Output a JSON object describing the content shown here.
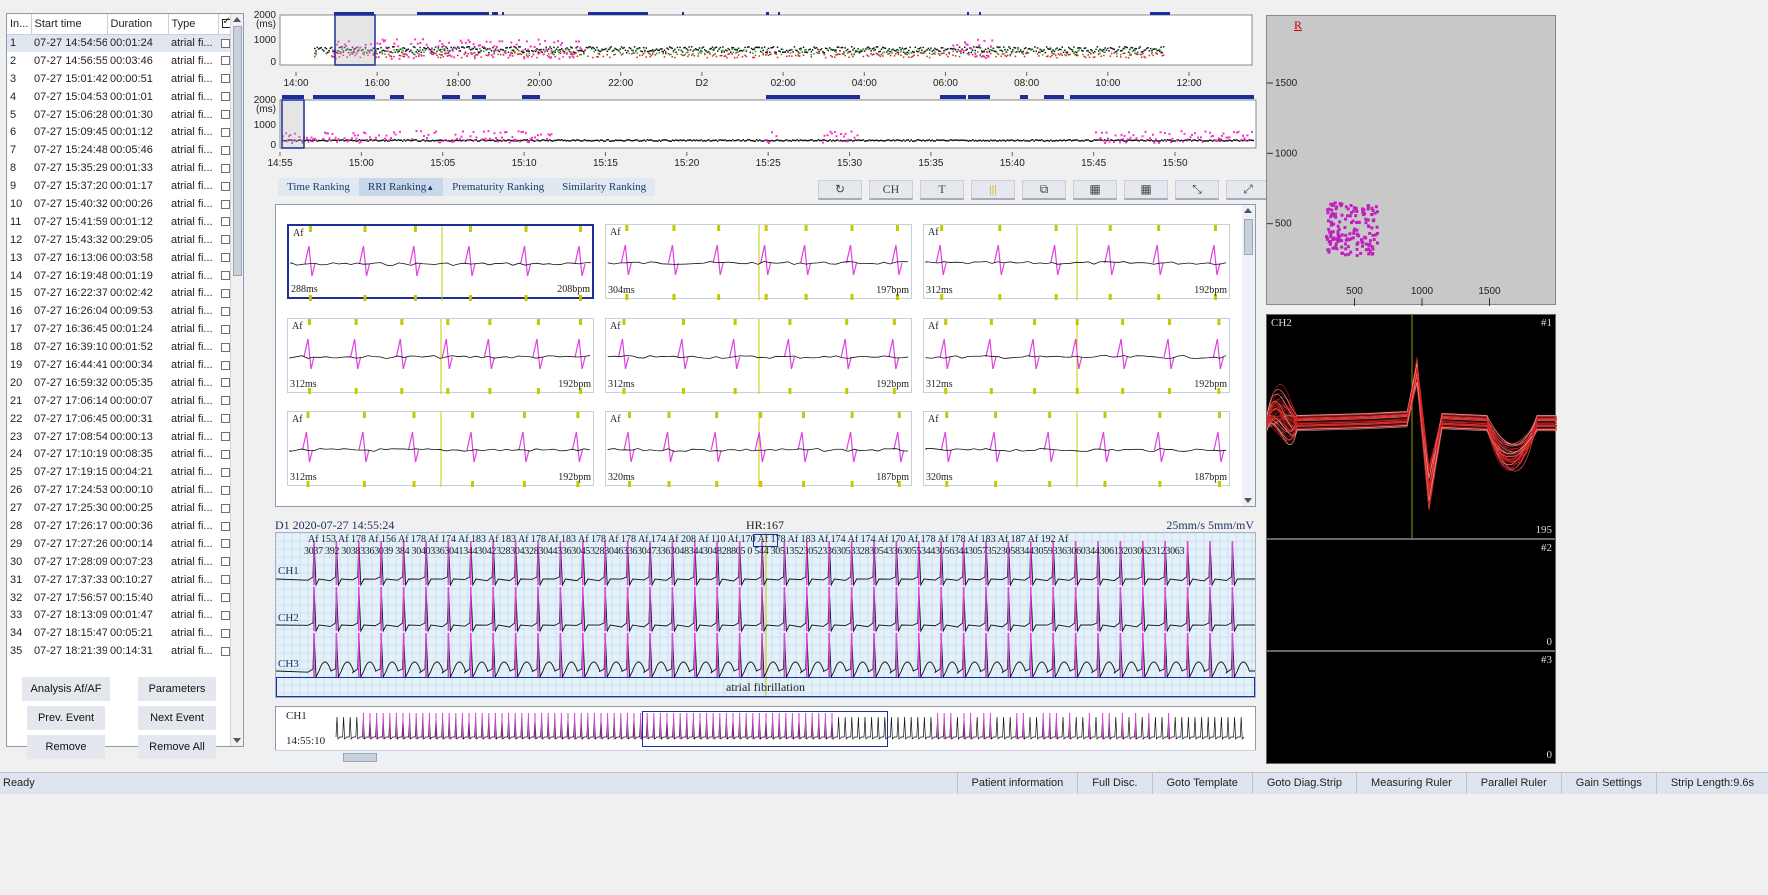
{
  "event_list": {
    "columns": [
      "In...",
      "Start time",
      "Duration",
      "Type"
    ],
    "header_checkbox_checked": true,
    "rows": [
      {
        "index": "1",
        "start": "07-27 14:54:56",
        "duration": "00:01:24",
        "type": "atrial fi..."
      },
      {
        "index": "2",
        "start": "07-27 14:56:55",
        "duration": "00:03:46",
        "type": "atrial fi..."
      },
      {
        "index": "3",
        "start": "07-27 15:01:42",
        "duration": "00:00:51",
        "type": "atrial fi..."
      },
      {
        "index": "4",
        "start": "07-27 15:04:53",
        "duration": "00:01:01",
        "type": "atrial fi..."
      },
      {
        "index": "5",
        "start": "07-27 15:06:28",
        "duration": "00:01:30",
        "type": "atrial fi..."
      },
      {
        "index": "6",
        "start": "07-27 15:09:45",
        "duration": "00:01:12",
        "type": "atrial fi..."
      },
      {
        "index": "7",
        "start": "07-27 15:24:48",
        "duration": "00:05:46",
        "type": "atrial fi..."
      },
      {
        "index": "8",
        "start": "07-27 15:35:29",
        "duration": "00:01:33",
        "type": "atrial fi..."
      },
      {
        "index": "9",
        "start": "07-27 15:37:20",
        "duration": "00:01:17",
        "type": "atrial fi..."
      },
      {
        "index": "10",
        "start": "07-27 15:40:32",
        "duration": "00:00:26",
        "type": "atrial fi..."
      },
      {
        "index": "11",
        "start": "07-27 15:41:59",
        "duration": "00:01:12",
        "type": "atrial fi..."
      },
      {
        "index": "12",
        "start": "07-27 15:43:32",
        "duration": "00:29:05",
        "type": "atrial fi..."
      },
      {
        "index": "13",
        "start": "07-27 16:13:06",
        "duration": "00:03:58",
        "type": "atrial fi..."
      },
      {
        "index": "14",
        "start": "07-27 16:19:48",
        "duration": "00:01:19",
        "type": "atrial fi..."
      },
      {
        "index": "15",
        "start": "07-27 16:22:37",
        "duration": "00:02:42",
        "type": "atrial fi..."
      },
      {
        "index": "16",
        "start": "07-27 16:26:04",
        "duration": "00:09:53",
        "type": "atrial fi..."
      },
      {
        "index": "17",
        "start": "07-27 16:36:45",
        "duration": "00:01:24",
        "type": "atrial fi..."
      },
      {
        "index": "18",
        "start": "07-27 16:39:10",
        "duration": "00:01:52",
        "type": "atrial fi..."
      },
      {
        "index": "19",
        "start": "07-27 16:44:41",
        "duration": "00:00:34",
        "type": "atrial fi..."
      },
      {
        "index": "20",
        "start": "07-27 16:59:32",
        "duration": "00:05:35",
        "type": "atrial fi..."
      },
      {
        "index": "21",
        "start": "07-27 17:06:14",
        "duration": "00:00:07",
        "type": "atrial fi..."
      },
      {
        "index": "22",
        "start": "07-27 17:06:45",
        "duration": "00:00:31",
        "type": "atrial fi..."
      },
      {
        "index": "23",
        "start": "07-27 17:08:54",
        "duration": "00:00:13",
        "type": "atrial fi..."
      },
      {
        "index": "24",
        "start": "07-27 17:10:19",
        "duration": "00:08:35",
        "type": "atrial fi..."
      },
      {
        "index": "25",
        "start": "07-27 17:19:15",
        "duration": "00:04:21",
        "type": "atrial fi..."
      },
      {
        "index": "26",
        "start": "07-27 17:24:53",
        "duration": "00:00:10",
        "type": "atrial fi..."
      },
      {
        "index": "27",
        "start": "07-27 17:25:30",
        "duration": "00:00:25",
        "type": "atrial fi..."
      },
      {
        "index": "28",
        "start": "07-27 17:26:17",
        "duration": "00:00:36",
        "type": "atrial fi..."
      },
      {
        "index": "29",
        "start": "07-27 17:27:26",
        "duration": "00:00:14",
        "type": "atrial fi..."
      },
      {
        "index": "30",
        "start": "07-27 17:28:09",
        "duration": "00:07:23",
        "type": "atrial fi..."
      },
      {
        "index": "31",
        "start": "07-27 17:37:33",
        "duration": "00:10:27",
        "type": "atrial fi..."
      },
      {
        "index": "32",
        "start": "07-27 17:56:57",
        "duration": "00:15:40",
        "type": "atrial fi..."
      },
      {
        "index": "33",
        "start": "07-27 18:13:09",
        "duration": "00:01:47",
        "type": "atrial fi..."
      },
      {
        "index": "34",
        "start": "07-27 18:15:47",
        "duration": "00:05:21",
        "type": "atrial fi..."
      },
      {
        "index": "35",
        "start": "07-27 18:21:39",
        "duration": "00:14:31",
        "type": "atrial fi..."
      }
    ]
  },
  "left_buttons": {
    "analysis": "Analysis Af/AF",
    "parameters": "Parameters",
    "prev_event": "Prev. Event",
    "next_event": "Next Event",
    "remove": "Remove",
    "remove_all": "Remove All"
  },
  "trend_top": {
    "y_ticks": [
      "2000",
      "(ms)",
      "1000",
      "0"
    ],
    "x_ticks": [
      "14:00",
      "16:00",
      "18:00",
      "20:00",
      "22:00",
      "D2",
      "02:00",
      "04:00",
      "06:00",
      "08:00",
      "10:00",
      "12:00"
    ]
  },
  "trend_bottom": {
    "y_ticks": [
      "2000",
      "(ms)",
      "1000",
      "0"
    ],
    "x_ticks": [
      "14:55",
      "15:00",
      "15:05",
      "15:10",
      "15:15",
      "15:20",
      "15:25",
      "15:30",
      "15:35",
      "15:40",
      "15:45",
      "15:50"
    ]
  },
  "ranking_tabs": [
    "Time Ranking",
    "RRI Ranking",
    "Prematurity Ranking",
    "Similarity Ranking"
  ],
  "active_tab": "RRI Ranking",
  "toolbar": {
    "refresh": "↻",
    "ch": "CH",
    "text": "T",
    "bars": "|||",
    "copy": "⧉",
    "grid4": "▦",
    "grid6": "▦",
    "shrink": "⤡",
    "expand": "⤢"
  },
  "templates": [
    {
      "label": "Af",
      "rr": "288ms",
      "bpm": "208bpm",
      "selected": true
    },
    {
      "label": "Af",
      "rr": "304ms",
      "bpm": "197bpm",
      "selected": false
    },
    {
      "label": "Af",
      "rr": "312ms",
      "bpm": "192bpm",
      "selected": false
    },
    {
      "label": "Af",
      "rr": "312ms",
      "bpm": "192bpm",
      "selected": false
    },
    {
      "label": "Af",
      "rr": "312ms",
      "bpm": "192bpm",
      "selected": false
    },
    {
      "label": "Af",
      "rr": "312ms",
      "bpm": "192bpm",
      "selected": false
    },
    {
      "label": "Af",
      "rr": "312ms",
      "bpm": "192bpm",
      "selected": false
    },
    {
      "label": "Af",
      "rr": "320ms",
      "bpm": "187bpm",
      "selected": false
    },
    {
      "label": "Af",
      "rr": "320ms",
      "bpm": "187bpm",
      "selected": false
    }
  ],
  "strip": {
    "header_left": "D1 2020-07-27 14:55:24",
    "header_hr": "HR:167",
    "header_right": "25mm/s 5mm/mV",
    "beat_labels_top": "Af   153   Af  178  Af   156   Af  178  Af  174  Af  183  Af  183  Af  178  Af  183  Af  178  Af  178  Af  174  Af 208 Af   110    Af  170  Af  178  Af  183  Af  174  Af  174  Af  170  Af  178  Af  178  Af  183  Af  187  Af 192  Af",
    "beat_labels_bottom": "3037 392  30383363039  384  30403363041344304232830432830443363045328304633630473363048344304828805   0   544    3051352305233630533283054336305534430563443057352305834430593363060344306132030623123063",
    "channels": [
      "CH1",
      "CH2",
      "CH3"
    ],
    "diagnosis": "atrial fibrillation"
  },
  "overview": {
    "channel": "CH1",
    "time": "14:55:10"
  },
  "scatter": {
    "label": "R",
    "y_ticks": [
      "1500",
      "1000",
      "500"
    ],
    "x_ticks": [
      "500",
      "1000",
      "1500"
    ]
  },
  "superimposed": {
    "panel1": {
      "channel": "CH2",
      "index": "#1",
      "count": "195"
    },
    "panel2": {
      "index": "#2",
      "count": "0"
    },
    "panel3": {
      "index": "#3",
      "count": "0"
    }
  },
  "status": {
    "ready": "Ready",
    "items": [
      "Patient information",
      "Full Disc.",
      "Goto Template",
      "Goto Diag.Strip",
      "Measuring Ruler",
      "Parallel Ruler",
      "Gain Settings",
      "Strip Length:9.6s"
    ]
  },
  "colors": {
    "accent": "#1c2f99",
    "af_beat": "#e040e0",
    "marker": "#c8c800",
    "trend_dots": "#ff33cc"
  }
}
